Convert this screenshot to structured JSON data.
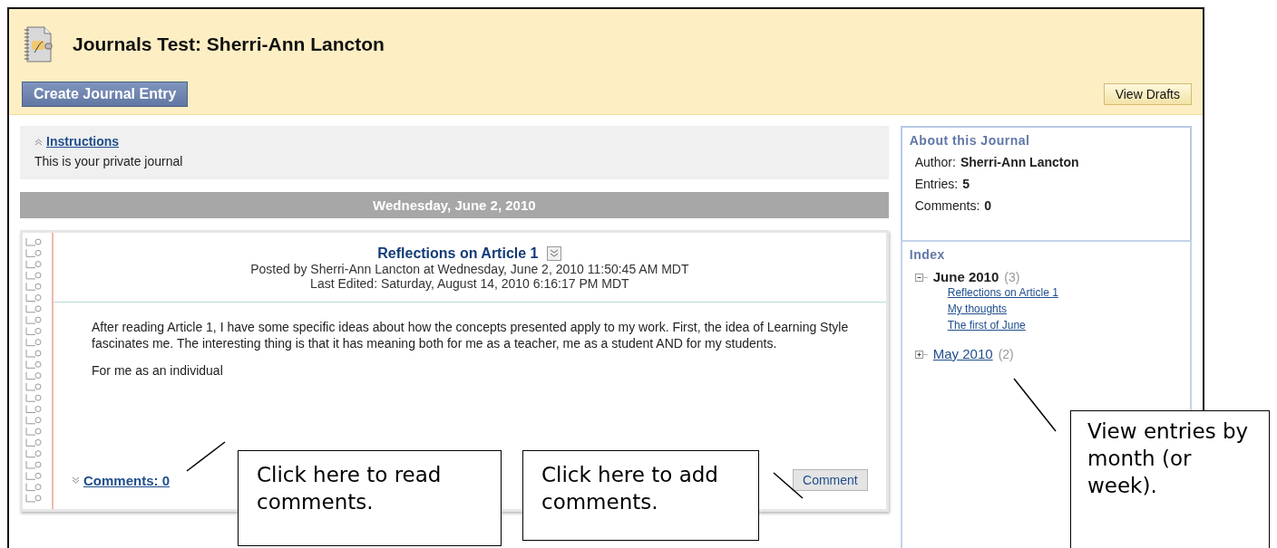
{
  "header": {
    "title": "Journals Test: Sherri-Ann Lancton",
    "create_button": "Create Journal Entry",
    "drafts_button": "View Drafts"
  },
  "instructions": {
    "title": "Instructions",
    "expanded": true,
    "text": "This is your private journal"
  },
  "date_bar": "Wednesday, June 2, 2010",
  "entry": {
    "title": "Reflections on Article 1",
    "posted": "Posted by  Sherri-Ann Lancton at  Wednesday, June 2, 2010 11:50:45 AM MDT",
    "edited": "Last Edited: Saturday, August 14, 2010 6:16:17 PM MDT",
    "paragraphs": [
      "After reading Article 1, I have some specific ideas about how the concepts presented apply to my work.  First, the idea of Learning Style fascinates me.  The interesting thing is that it has meaning both for me as a teacher, me as a student AND for my students.",
      "For me as an individual"
    ],
    "comments_link": "Comments: 0",
    "comment_button": "Comment"
  },
  "about": {
    "title": "About this Journal",
    "rows": [
      {
        "label": "Author:",
        "value": "Sherri-Ann Lancton"
      },
      {
        "label": "Entries:",
        "value": "5"
      },
      {
        "label": "Comments:",
        "value": "0"
      }
    ]
  },
  "index": {
    "title": "Index",
    "months": [
      {
        "label": "June 2010",
        "count": "(3)",
        "expanded": true,
        "children": [
          {
            "label": "Reflections on Article 1"
          },
          {
            "label": "My thoughts"
          },
          {
            "label": "The first of June"
          }
        ]
      },
      {
        "label": "May 2010",
        "count": "(2)",
        "expanded": false
      }
    ]
  },
  "callouts": [
    {
      "text": "Click here to read comments."
    },
    {
      "text": "Click here to add comments."
    },
    {
      "text": "View entries by month (or week)."
    }
  ]
}
